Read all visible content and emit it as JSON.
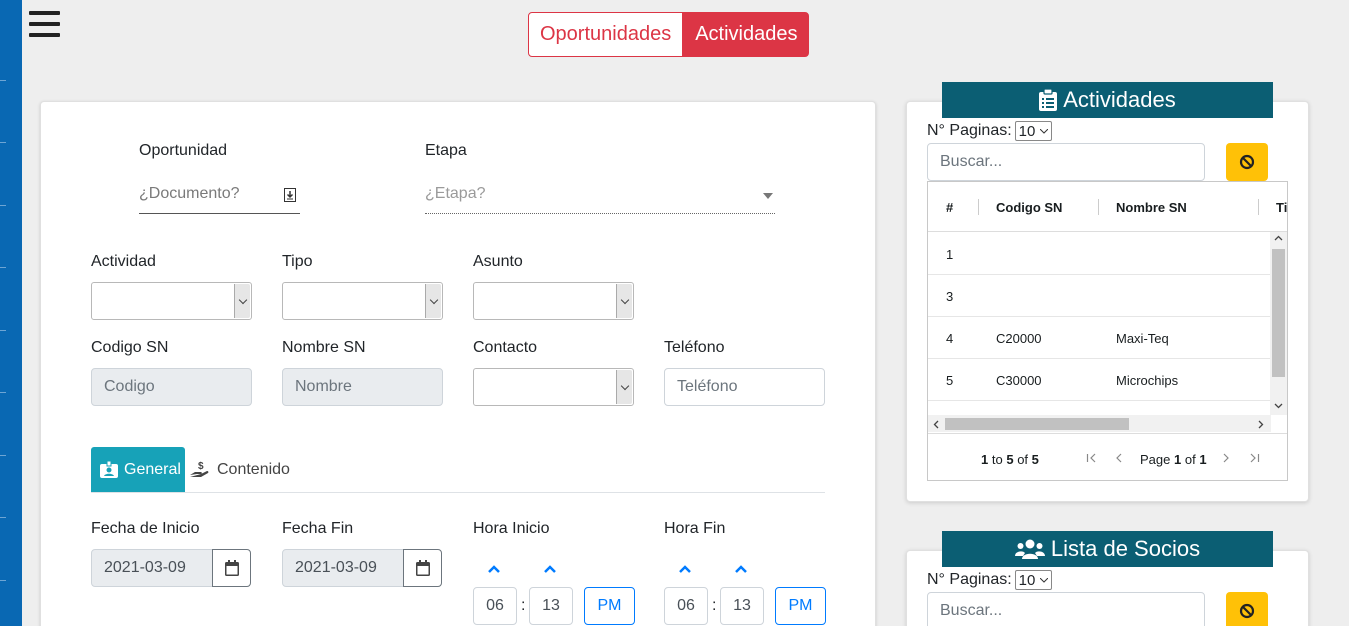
{
  "nav": {
    "toggle_opp": "Oportunidades",
    "toggle_act": "Actividades"
  },
  "form": {
    "oportunidad_label": "Oportunidad",
    "oportunidad_placeholder": "¿Documento?",
    "etapa_label": "Etapa",
    "etapa_placeholder": "¿Etapa?",
    "actividad_label": "Actividad",
    "tipo_label": "Tipo",
    "asunto_label": "Asunto",
    "codigo_sn_label": "Codigo SN",
    "codigo_sn_placeholder": "Codigo",
    "nombre_sn_label": "Nombre SN",
    "nombre_sn_placeholder": "Nombre",
    "contacto_label": "Contacto",
    "telefono_label": "Teléfono",
    "telefono_placeholder": "Teléfono"
  },
  "tabs": {
    "general": "General",
    "contenido": "Contenido"
  },
  "schedule": {
    "fecha_inicio_label": "Fecha de Inicio",
    "fecha_inicio_value": "2021-03-09",
    "fecha_fin_label": "Fecha Fin",
    "fecha_fin_value": "2021-03-09",
    "hora_inicio_label": "Hora Inicio",
    "hora_inicio": {
      "hour": "06",
      "minute": "13",
      "meridian": "PM"
    },
    "hora_fin_label": "Hora Fin",
    "hora_fin": {
      "hour": "06",
      "minute": "13",
      "meridian": "PM"
    },
    "colon": ":"
  },
  "actividades_panel": {
    "title": "Actividades",
    "npag_label": "N° Paginas:",
    "npag_value": "10",
    "search_placeholder": "Buscar...",
    "columns": [
      "#",
      "Codigo SN",
      "Nombre SN",
      "Ti"
    ],
    "rows": [
      {
        "num": "1",
        "codigo": "",
        "nombre": ""
      },
      {
        "num": "3",
        "codigo": "",
        "nombre": ""
      },
      {
        "num": "4",
        "codigo": "C20000",
        "nombre": "Maxi-Teq"
      },
      {
        "num": "5",
        "codigo": "C30000",
        "nombre": "Microchips"
      }
    ],
    "footer": {
      "from": "1",
      "to_word": "to",
      "to": "5",
      "of_word": "of",
      "total": "5",
      "page_word": "Page",
      "page": "1",
      "page_of": "of",
      "pages": "1"
    }
  },
  "socios_panel": {
    "title": "Lista de Socios",
    "npag_label": "N° Paginas:",
    "npag_value": "10",
    "search_placeholder": "Buscar..."
  },
  "colors": {
    "accent_red": "#dc3545",
    "tab_teal": "#17a2b8",
    "header_teal": "#0b5e73",
    "warning": "#ffc107",
    "sidebar_blue": "#0968b3"
  }
}
